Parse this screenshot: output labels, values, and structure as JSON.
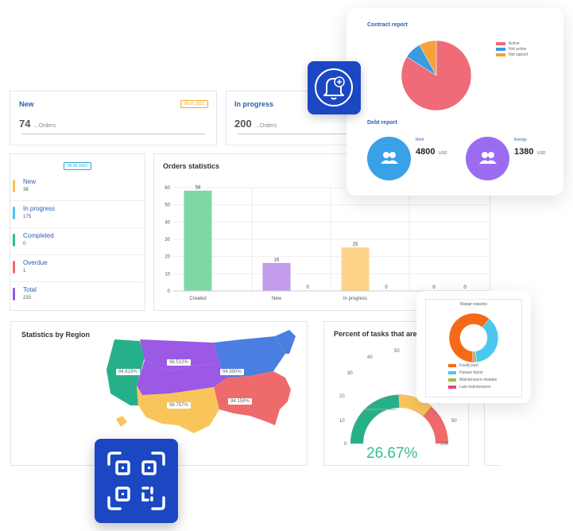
{
  "new_card": {
    "title": "New",
    "date": "06.07.2022",
    "count": "74",
    "suffix": "...Orders"
  },
  "progress_card": {
    "title": "In progress",
    "count": "200",
    "suffix": "...Orders"
  },
  "status_panel": {
    "date": "06.06.2022",
    "items": [
      {
        "label": "New",
        "value": "38",
        "color": "#f6c453"
      },
      {
        "label": "In progress",
        "value": "175",
        "color": "#4fc3e8"
      },
      {
        "label": "Completed",
        "value": "0",
        "color": "#2fbf8a"
      },
      {
        "label": "Overdue",
        "value": "1",
        "color": "#ef6b6b"
      },
      {
        "label": "Total",
        "value": "233",
        "color": "#9b59e6"
      }
    ]
  },
  "orders_statistics": {
    "title": "Orders statistics",
    "chart_data": {
      "type": "bar",
      "categories": [
        "Created",
        "New",
        "In progress",
        ""
      ],
      "values": [
        58,
        16,
        25,
        0
      ],
      "extra_values": [
        0,
        0,
        0,
        0
      ],
      "bar_colors": [
        "#7fd8a3",
        "#c29bec",
        "#fdd48a",
        "#cccccc"
      ],
      "ylim": [
        0,
        60
      ],
      "yticks": [
        "0",
        "10",
        "20",
        "30",
        "40",
        "50",
        "60"
      ],
      "labels": [
        "58",
        "16",
        "25",
        "0"
      ],
      "extra_labels": [
        "",
        "0",
        "0",
        "0"
      ]
    }
  },
  "contract_report": {
    "title": "Contract report",
    "chart_data": {
      "type": "pie",
      "slices": [
        {
          "name": "Active",
          "value": 84,
          "color": "#ef6b78"
        },
        {
          "name": "Not active",
          "value": 8,
          "color": "#3b9be0"
        },
        {
          "name": "Not signed",
          "value": 8,
          "color": "#f7a13b"
        }
      ]
    }
  },
  "debt_report": {
    "title": "Debt report",
    "rent": {
      "label": "Rent",
      "amount": "4800",
      "currency": "USD",
      "color": "#3aa0e8"
    },
    "energy": {
      "label": "Energy",
      "amount": "1380",
      "currency": "USD",
      "color": "#9b6cf0"
    }
  },
  "statistics_by_region": {
    "title": "Statistics by Region",
    "labels": [
      "94.619%",
      "96.512%",
      "94.990%",
      "96.757%",
      "94.158%"
    ]
  },
  "percent_tasks": {
    "title": "Percent of tasks that are",
    "value": "26.67%",
    "ticks": [
      "0",
      "10",
      "20",
      "30",
      "40",
      "50",
      "90",
      "100"
    ]
  },
  "repair_reasons": {
    "title": "Repair reasons",
    "chart_data": {
      "type": "pie",
      "slices": [
        {
          "name": "Faulty part",
          "value": 60,
          "color": "#f46a16"
        },
        {
          "name": "Human factor",
          "value": 37,
          "color": "#4cc8ef"
        },
        {
          "name": "Maintenance mistake",
          "value": 2,
          "color": "#9ebf3a"
        },
        {
          "name": "Late maintenance",
          "value": 1,
          "color": "#e8418a"
        }
      ]
    }
  },
  "colors": {
    "accent": "#2a5fb0",
    "icon_bg": "#1b48c2"
  }
}
